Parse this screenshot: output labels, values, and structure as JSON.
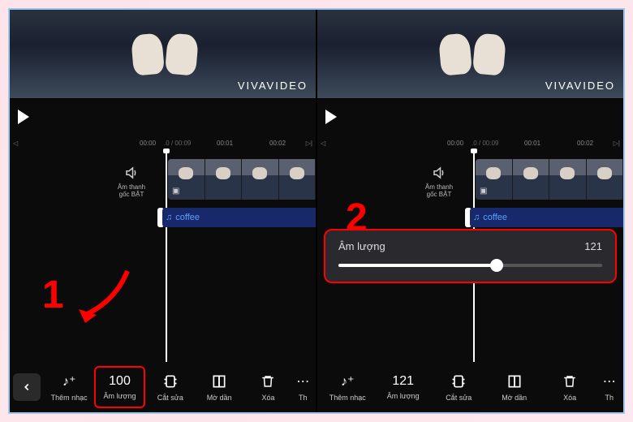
{
  "watermark": "VIVAVIDEO",
  "ruler": {
    "t1": "00:00",
    "t2": ".0 / 00:09",
    "t3": "00:01",
    "t4": "00:02"
  },
  "sound_toggle": {
    "line1": "Âm thanh",
    "line2": "gốc BẬT"
  },
  "audio_clip": "coffee",
  "left": {
    "step": "1",
    "volume_value": "100",
    "tools": {
      "add_music": "Thêm nhạc",
      "volume": "Âm lượng",
      "trim": "Cắt sửa",
      "fade": "Mờ dần",
      "delete": "Xóa",
      "more": "Th"
    }
  },
  "right": {
    "step": "2",
    "volume_value": "121",
    "panel": {
      "label": "Âm lượng",
      "value": "121",
      "percent": 60
    },
    "tools": {
      "add_music": "Thêm nhạc",
      "volume": "Âm lượng",
      "trim": "Cắt sửa",
      "fade": "Mờ dần",
      "delete": "Xóa",
      "more": "Th"
    }
  }
}
